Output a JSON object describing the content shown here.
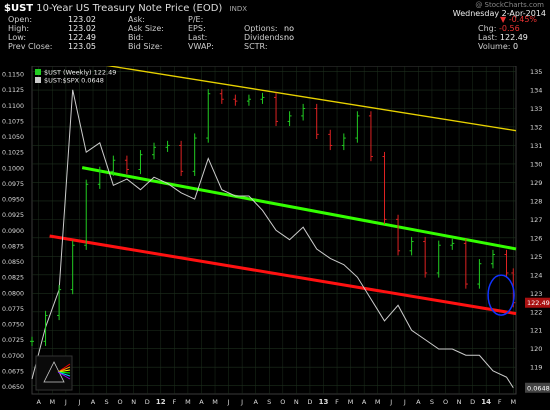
{
  "header": {
    "symbol": "$UST",
    "name": "10-Year US Treasury Note Price (EOD)",
    "index_tag": "INDX",
    "watermark": "@ StockCharts.com",
    "date": "Wednesday 2-Apr-2014",
    "change_label": "Chg:",
    "change_value": "-0.56",
    "change_pct": "-0.45%",
    "last_label": "Last:",
    "last_value": "122.49",
    "volume_label": "Volume:",
    "volume_value": "0",
    "quote": [
      {
        "label": "Open:",
        "value": "123.02"
      },
      {
        "label": "High:",
        "value": "123.02"
      },
      {
        "label": "Low:",
        "value": "122.49"
      },
      {
        "label": "Prev Close:",
        "value": "123.05"
      }
    ],
    "quote2": [
      {
        "label": "Ask:",
        "value": ""
      },
      {
        "label": "Ask Size:",
        "value": ""
      },
      {
        "label": "Bid:",
        "value": ""
      },
      {
        "label": "Bid Size:",
        "value": ""
      }
    ],
    "quote3": [
      {
        "label": "P/E:",
        "value": ""
      },
      {
        "label": "EPS:",
        "value": ""
      },
      {
        "label": "Last:",
        "value": ""
      },
      {
        "label": "VWAP:",
        "value": ""
      }
    ],
    "quote4": [
      {
        "label": "Options:",
        "value": "no"
      },
      {
        "label": "Dividends:",
        "value": "no"
      },
      {
        "label": "SCTR:",
        "value": ""
      }
    ]
  },
  "colors": {
    "background": "#000000",
    "grid": "#1e2f1e",
    "up": "#22cc22",
    "down": "#dd2222",
    "ratio_line": "#cccccc",
    "upper_trend": "#e8d200",
    "middle_trend": "#33ff00",
    "lower_trend": "#ff1111",
    "highlight_circle": "#1133ff",
    "last_box": "#aa1111"
  },
  "chart_data": {
    "type": "line",
    "legend": [
      {
        "label": "$UST (Weekly) 122.49",
        "color": "#22cc22"
      },
      {
        "label": "$UST:$SPX 0.0648",
        "color": "#cccccc"
      }
    ],
    "left_axis": {
      "ticks": [
        "0.1150",
        "0.1125",
        "0.1100",
        "0.1075",
        "0.1050",
        "0.1025",
        "0.1000",
        "0.0975",
        "0.0950",
        "0.0925",
        "0.0900",
        "0.0875",
        "0.0850",
        "0.0825",
        "0.0800",
        "0.0775",
        "0.0750",
        "0.0725",
        "0.0700",
        "0.0675",
        "0.0650"
      ],
      "ylim": [
        0.0638,
        0.1163
      ]
    },
    "right_axis": {
      "ticks": [
        "135",
        "134",
        "133",
        "132",
        "131",
        "130",
        "129",
        "128",
        "127",
        "126",
        "125",
        "124",
        "123",
        "122",
        "121",
        "120",
        "119",
        "118"
      ],
      "ylim": [
        117.55,
        135.3
      ]
    },
    "x_axis": {
      "labels": [
        "A",
        "M",
        "J",
        "J",
        "A",
        "S",
        "O",
        "N",
        "D",
        "12",
        "F",
        "M",
        "A",
        "M",
        "J",
        "J",
        "A",
        "S",
        "O",
        "N",
        "D",
        "13",
        "F",
        "M",
        "A",
        "M",
        "J",
        "J",
        "A",
        "S",
        "O",
        "N",
        "D",
        "14",
        "F",
        "M"
      ],
      "bold": [
        "12",
        "13",
        "14"
      ],
      "t_start": 0,
      "t_end": 35.7
    },
    "price_series": {
      "name": "$UST (Weekly)",
      "t": [
        0,
        1,
        2,
        3,
        4,
        5,
        6,
        7,
        8,
        9,
        10,
        11,
        12,
        13,
        14,
        15,
        16,
        17,
        18,
        19,
        20,
        21,
        22,
        23,
        24,
        25,
        26,
        27,
        28,
        29,
        30,
        31,
        32,
        33,
        34,
        35,
        35.5
      ],
      "close": [
        120.4,
        121.8,
        123.2,
        125.6,
        128.9,
        129.6,
        130.2,
        129.7,
        130.5,
        130.9,
        131.0,
        129.6,
        131.4,
        133.8,
        133.5,
        133.4,
        133.5,
        133.6,
        132.3,
        132.6,
        133.0,
        131.6,
        131.0,
        131.4,
        132.6,
        130.4,
        127.0,
        125.3,
        125.8,
        124.1,
        125.6,
        125.7,
        123.5,
        124.6,
        125.1,
        124.1,
        122.49
      ]
    },
    "ratio_series": {
      "name": "$UST:$SPX",
      "t": [
        0,
        1,
        2,
        3,
        4,
        5,
        6,
        7,
        8,
        9,
        10,
        11,
        12,
        13,
        14,
        15,
        16,
        17,
        18,
        19,
        20,
        21,
        22,
        23,
        24,
        25,
        26,
        27,
        28,
        29,
        30,
        31,
        32,
        33,
        34,
        35,
        35.5
      ],
      "value": [
        0.0662,
        0.0745,
        0.0805,
        0.1125,
        0.1025,
        0.104,
        0.0972,
        0.0982,
        0.0965,
        0.0985,
        0.0975,
        0.096,
        0.095,
        0.1015,
        0.0965,
        0.0955,
        0.0955,
        0.0932,
        0.09,
        0.0885,
        0.0905,
        0.087,
        0.0855,
        0.0845,
        0.0825,
        0.079,
        0.0755,
        0.078,
        0.074,
        0.0725,
        0.071,
        0.071,
        0.07,
        0.07,
        0.0675,
        0.0665,
        0.0648
      ]
    },
    "trendlines": [
      {
        "name": "upper",
        "from": {
          "t": 4.9,
          "v": 135.4
        },
        "to": {
          "t": 35.7,
          "v": 131.8
        }
      },
      {
        "name": "middle",
        "from": {
          "t": 3.7,
          "v": 129.8
        },
        "to": {
          "t": 35.7,
          "v": 125.4
        }
      },
      {
        "name": "lower",
        "from": {
          "t": 1.3,
          "v": 126.1
        },
        "to": {
          "t": 35.7,
          "v": 121.9
        }
      }
    ],
    "highlight": {
      "t": 34.6,
      "v": 122.9
    },
    "last_label": "122.49",
    "last_ratio_label": "0.0648"
  }
}
